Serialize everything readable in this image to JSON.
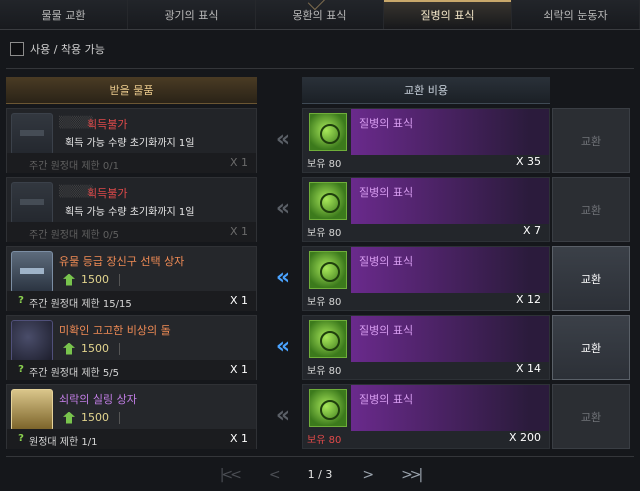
{
  "tabs": [
    {
      "label": "물물 교환",
      "active": false
    },
    {
      "label": "광기의 표식",
      "active": false
    },
    {
      "label": "몽환의 표식",
      "active": false
    },
    {
      "label": "질병의 표식",
      "active": true
    },
    {
      "label": "쇠락의 눈동자",
      "active": false
    }
  ],
  "filter": {
    "label": "사용 / 착용 가능",
    "checked": false
  },
  "headers": {
    "receive": "받을 물품",
    "cost": "교환 비용"
  },
  "unavailable_label": "획득불가",
  "rows": [
    {
      "state": "disabled",
      "icon": "chest-icon",
      "note": "획득 가능 수량 초기화까지 1일",
      "limit": "주간 원정대 제한 0/1",
      "quantity": "X 1",
      "cost_name": "질병의 표식",
      "owned": "보유 80",
      "cost_qty": "X 35",
      "button": "교환"
    },
    {
      "state": "disabled",
      "icon": "chest-icon",
      "note": "획득 가능 수량 초기화까지 1일",
      "limit": "주간 원정대 제한 0/5",
      "quantity": "X 1",
      "cost_name": "질병의 표식",
      "owned": "보유 80",
      "cost_qty": "X 7",
      "button": "교환"
    },
    {
      "state": "enabled",
      "icon": "chest-icon",
      "name": "유물 등급 장신구 선택 상자",
      "price": "1500",
      "limit": "주간 원정대 제한 15/15",
      "quantity": "X 1",
      "cost_name": "질병의 표식",
      "owned": "보유 80",
      "cost_qty": "X 12",
      "button": "교환"
    },
    {
      "state": "enabled",
      "icon": "stone-icon",
      "name": "미확인 고고한 비상의 돌",
      "price": "1500",
      "limit": "주간 원정대 제한 5/5",
      "quantity": "X 1",
      "cost_name": "질병의 표식",
      "owned": "보유 80",
      "cost_qty": "X 14",
      "button": "교환"
    },
    {
      "state": "insufficient",
      "icon": "gold-chest-icon",
      "name": "쇠락의 실링 상자",
      "price": "1500",
      "limit": "원정대 제한 1/1",
      "quantity": "X 1",
      "cost_name": "질병의 표식",
      "owned": "보유 80",
      "cost_qty": "X 200",
      "button": "교환"
    }
  ],
  "pagination": {
    "first": "|<<",
    "prev": "<",
    "text": "1 / 3",
    "next": ">",
    "last": ">>|"
  },
  "colors": {
    "accent": "#c9a86b",
    "active_arrow": "#4aa3ff",
    "unavailable": "#e04a4a",
    "cost_purple": "#6a2a8c"
  }
}
